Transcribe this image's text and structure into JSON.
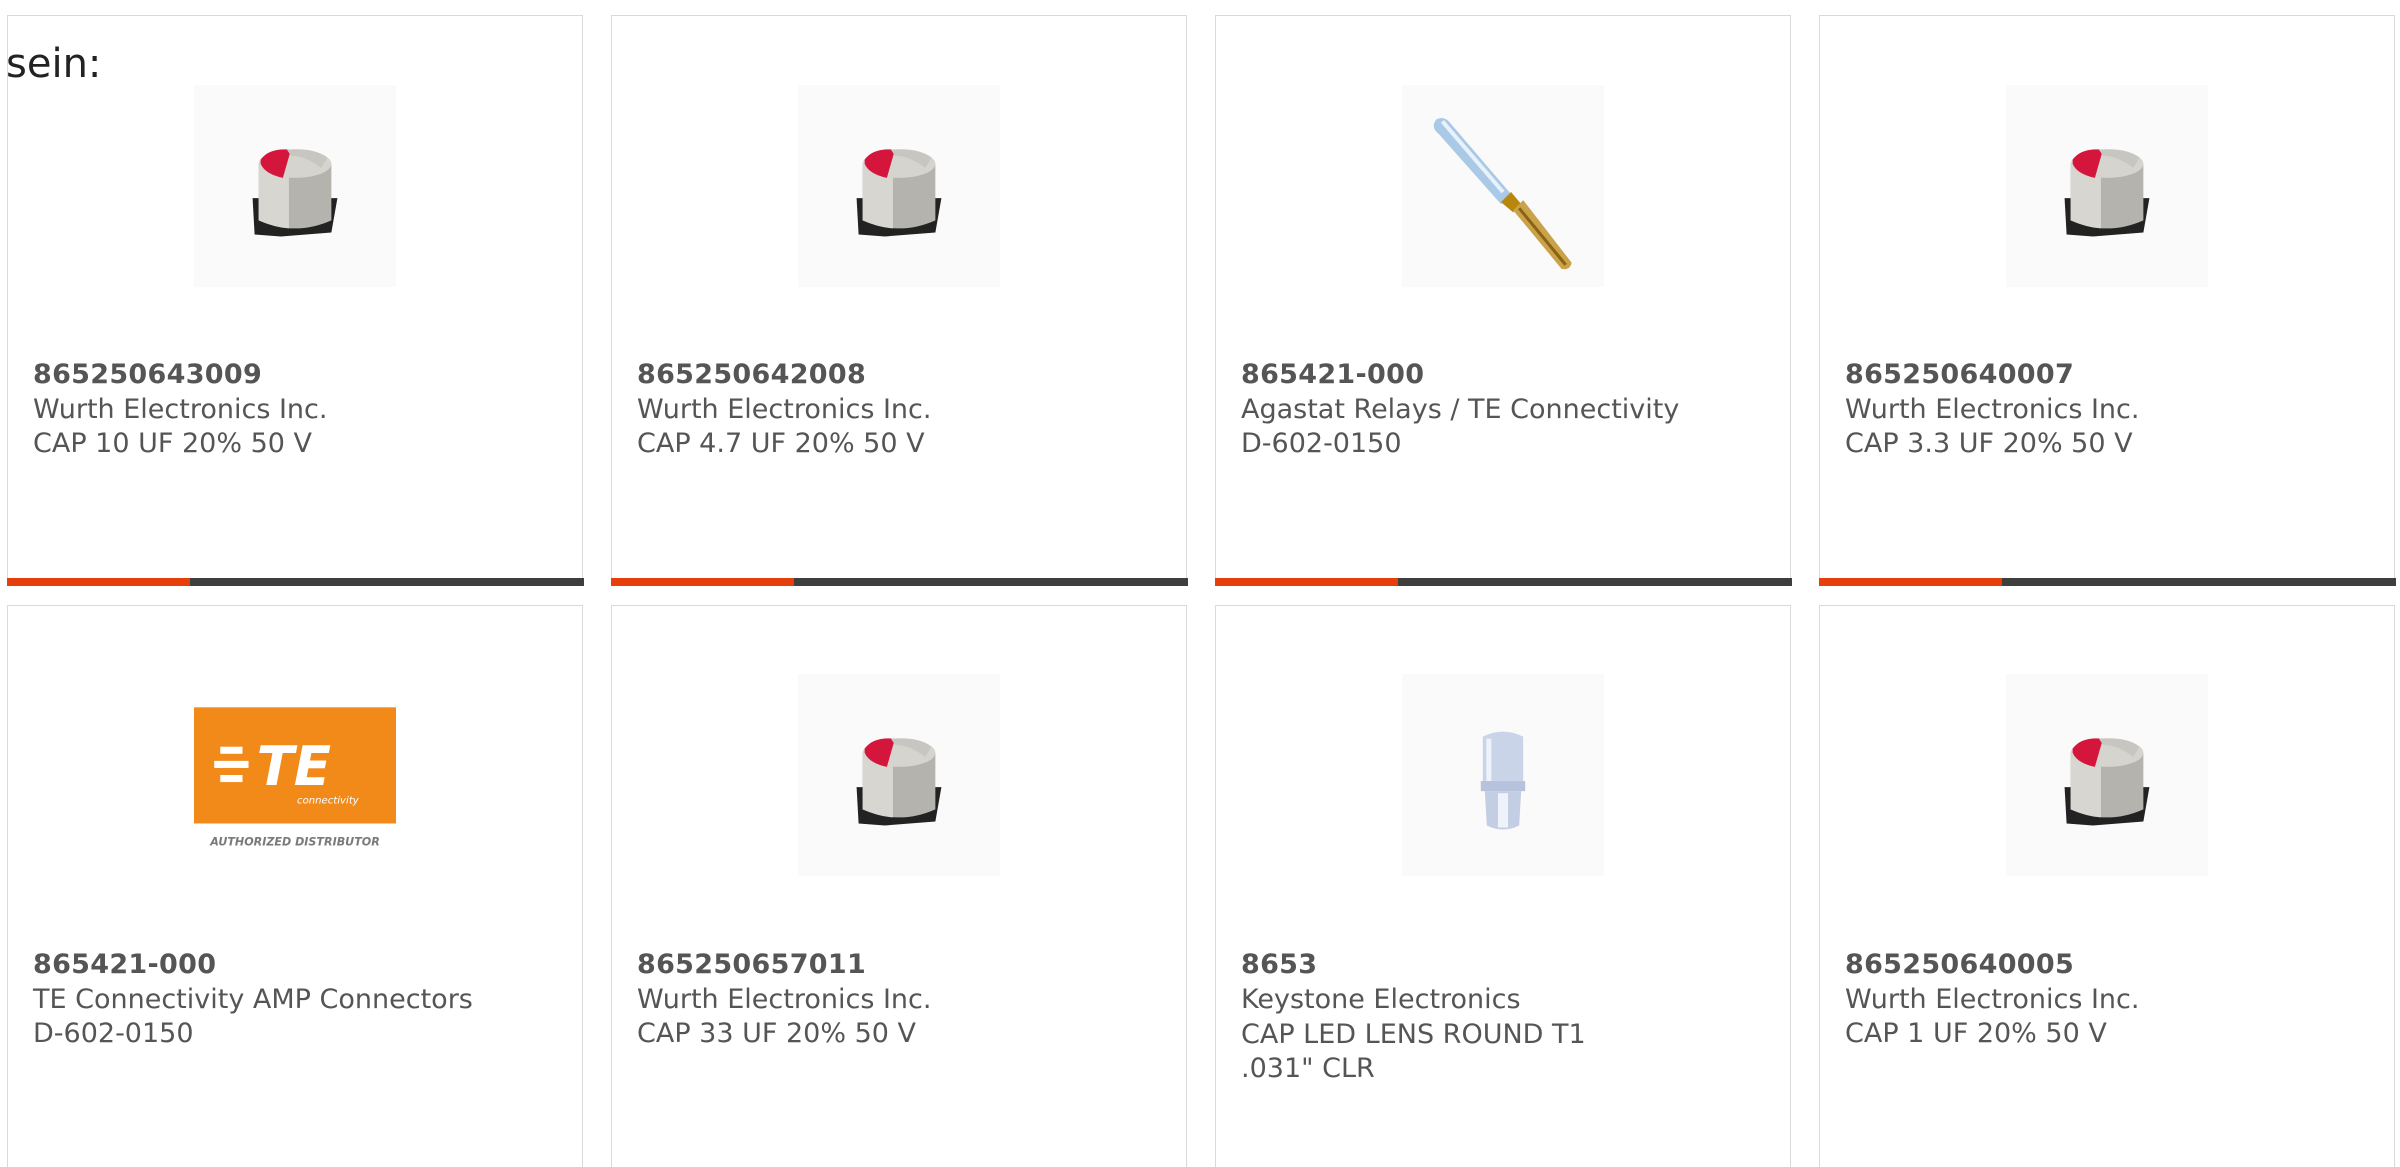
{
  "intro": "sein:",
  "products": [
    {
      "part_number": "865250643009",
      "manufacturer": "Wurth Electronics Inc.",
      "description": "CAP 10 UF 20% 50 V",
      "image_icon": "capacitor-image"
    },
    {
      "part_number": "865250642008",
      "manufacturer": "Wurth Electronics Inc.",
      "description": "CAP 4.7 UF 20% 50 V",
      "image_icon": "capacitor-image"
    },
    {
      "part_number": "865421-000",
      "manufacturer": "Agastat Relays / TE Connectivity",
      "description": "D-602-0150",
      "image_icon": "connector-contact-image"
    },
    {
      "part_number": "865250640007",
      "manufacturer": "Wurth Electronics Inc.",
      "description": "CAP 3.3 UF 20% 50 V",
      "image_icon": "capacitor-image"
    },
    {
      "part_number": "865421-000",
      "manufacturer": "TE Connectivity AMP Connectors",
      "description": "D-602-0150",
      "image_icon": "te-logo-image",
      "logo_text": "TE",
      "logo_subtext": "connectivity",
      "logo_caption": "AUTHORIZED DISTRIBUTOR"
    },
    {
      "part_number": "865250657011",
      "manufacturer": "Wurth Electronics Inc.",
      "description": "CAP 33 UF 20% 50 V",
      "image_icon": "capacitor-image"
    },
    {
      "part_number": "8653",
      "manufacturer": "Keystone Electronics",
      "description": "CAP LED LENS ROUND T1 .031\" CLR",
      "image_icon": "led-lens-cap-image"
    },
    {
      "part_number": "865250640005",
      "manufacturer": "Wurth Electronics Inc.",
      "description": "CAP 1 UF 20% 50 V",
      "image_icon": "capacitor-image"
    }
  ],
  "colors": {
    "accent": "#e63f0c",
    "bar": "#3e3e3e",
    "text": "#555555",
    "te_orange": "#f28a1a"
  }
}
